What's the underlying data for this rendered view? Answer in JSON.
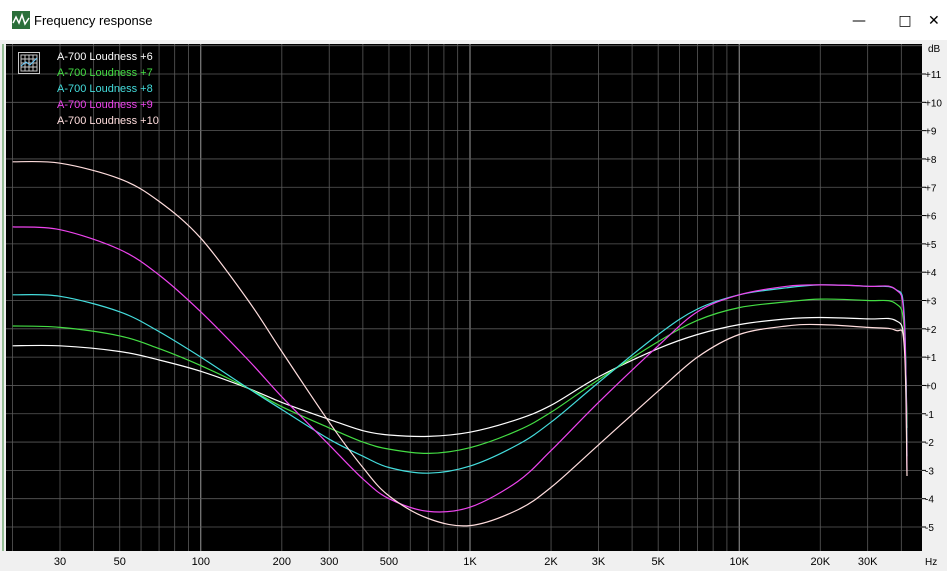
{
  "window": {
    "title": "Frequency response",
    "minimize_icon": "minimize-icon",
    "maximize_icon": "maximize-icon",
    "close_icon": "close-icon"
  },
  "chart_data": {
    "type": "line",
    "title": "",
    "xlabel": "",
    "ylabel": "",
    "x_unit": "Hz",
    "y_unit": "dB",
    "x_scale": "log",
    "xlim": [
      20,
      22000
    ],
    "ylim": [
      -5.5,
      12
    ],
    "x_tick_labels": [
      {
        "value": 30,
        "label": "30"
      },
      {
        "value": 50,
        "label": "50"
      },
      {
        "value": 100,
        "label": "100"
      },
      {
        "value": 200,
        "label": "200"
      },
      {
        "value": 300,
        "label": "300"
      },
      {
        "value": 500,
        "label": "500"
      },
      {
        "value": 1000,
        "label": "1K"
      },
      {
        "value": 2000,
        "label": "2K"
      },
      {
        "value": 3000,
        "label": "3K"
      },
      {
        "value": 5000,
        "label": "5K"
      },
      {
        "value": 10000,
        "label": "10K"
      },
      {
        "value": 20000,
        "label": "20K"
      },
      {
        "value": 30000,
        "label": "30K"
      }
    ],
    "y_tick_labels": [
      {
        "value": 11,
        "label": "+11"
      },
      {
        "value": 10,
        "label": "+10"
      },
      {
        "value": 9,
        "label": "+9"
      },
      {
        "value": 8,
        "label": "+8"
      },
      {
        "value": 7,
        "label": "+7"
      },
      {
        "value": 6,
        "label": "+6"
      },
      {
        "value": 5,
        "label": "+5"
      },
      {
        "value": 4,
        "label": "+4"
      },
      {
        "value": 3,
        "label": "+3"
      },
      {
        "value": 2,
        "label": "+2"
      },
      {
        "value": 1,
        "label": "+1"
      },
      {
        "value": 0,
        "label": "+0"
      },
      {
        "value": -1,
        "label": "-1"
      },
      {
        "value": -2,
        "label": "-2"
      },
      {
        "value": -3,
        "label": "-3"
      },
      {
        "value": -4,
        "label": "-4"
      },
      {
        "value": -5,
        "label": "-5"
      }
    ],
    "grid": true,
    "legend_position": "top-left",
    "background": "#000000",
    "series": [
      {
        "name": "A-700 Loudness +6",
        "color": "#ffffff",
        "points": [
          [
            20,
            1.4
          ],
          [
            30,
            1.4
          ],
          [
            50,
            1.2
          ],
          [
            70,
            0.9
          ],
          [
            100,
            0.5
          ],
          [
            150,
            -0.1
          ],
          [
            200,
            -0.6
          ],
          [
            300,
            -1.2
          ],
          [
            400,
            -1.6
          ],
          [
            500,
            -1.75
          ],
          [
            700,
            -1.8
          ],
          [
            1000,
            -1.65
          ],
          [
            1500,
            -1.2
          ],
          [
            2000,
            -0.7
          ],
          [
            3000,
            0.3
          ],
          [
            5000,
            1.3
          ],
          [
            7000,
            1.8
          ],
          [
            10000,
            2.15
          ],
          [
            15000,
            2.35
          ],
          [
            20000,
            2.4
          ],
          [
            30000,
            2.35
          ],
          [
            38000,
            2.3
          ],
          [
            41000,
            1.6
          ],
          [
            42000,
            -1.5
          ]
        ]
      },
      {
        "name": "A-700 Loudness +7",
        "color": "#44dd44",
        "points": [
          [
            20,
            2.1
          ],
          [
            30,
            2.05
          ],
          [
            50,
            1.75
          ],
          [
            70,
            1.3
          ],
          [
            100,
            0.7
          ],
          [
            150,
            -0.1
          ],
          [
            200,
            -0.75
          ],
          [
            300,
            -1.5
          ],
          [
            400,
            -2.0
          ],
          [
            500,
            -2.25
          ],
          [
            700,
            -2.4
          ],
          [
            1000,
            -2.2
          ],
          [
            1500,
            -1.6
          ],
          [
            2000,
            -0.95
          ],
          [
            3000,
            0.2
          ],
          [
            5000,
            1.55
          ],
          [
            7000,
            2.3
          ],
          [
            10000,
            2.75
          ],
          [
            15000,
            2.95
          ],
          [
            20000,
            3.05
          ],
          [
            30000,
            3.0
          ],
          [
            38000,
            2.9
          ],
          [
            41000,
            2.0
          ],
          [
            42000,
            -2.0
          ]
        ]
      },
      {
        "name": "A-700 Loudness +8",
        "color": "#44dddd",
        "points": [
          [
            20,
            3.2
          ],
          [
            30,
            3.15
          ],
          [
            50,
            2.6
          ],
          [
            70,
            1.9
          ],
          [
            100,
            1.0
          ],
          [
            150,
            -0.1
          ],
          [
            200,
            -0.85
          ],
          [
            300,
            -1.9
          ],
          [
            400,
            -2.5
          ],
          [
            500,
            -2.9
          ],
          [
            700,
            -3.1
          ],
          [
            1000,
            -2.85
          ],
          [
            1500,
            -2.1
          ],
          [
            2000,
            -1.3
          ],
          [
            3000,
            0.1
          ],
          [
            5000,
            1.8
          ],
          [
            7000,
            2.7
          ],
          [
            10000,
            3.2
          ],
          [
            15000,
            3.45
          ],
          [
            20000,
            3.55
          ],
          [
            30000,
            3.5
          ],
          [
            38000,
            3.4
          ],
          [
            41000,
            2.5
          ],
          [
            42000,
            -2.5
          ]
        ]
      },
      {
        "name": "A-700 Loudness +9",
        "color": "#ee44ee",
        "points": [
          [
            20,
            5.6
          ],
          [
            30,
            5.5
          ],
          [
            50,
            4.8
          ],
          [
            70,
            3.9
          ],
          [
            100,
            2.6
          ],
          [
            150,
            0.9
          ],
          [
            200,
            -0.4
          ],
          [
            300,
            -2.1
          ],
          [
            400,
            -3.3
          ],
          [
            500,
            -4.0
          ],
          [
            700,
            -4.45
          ],
          [
            1000,
            -4.3
          ],
          [
            1500,
            -3.4
          ],
          [
            2000,
            -2.3
          ],
          [
            3000,
            -0.6
          ],
          [
            5000,
            1.4
          ],
          [
            7000,
            2.6
          ],
          [
            10000,
            3.2
          ],
          [
            15000,
            3.5
          ],
          [
            20000,
            3.55
          ],
          [
            30000,
            3.5
          ],
          [
            38000,
            3.4
          ],
          [
            41000,
            2.3
          ],
          [
            42000,
            -3.0
          ]
        ]
      },
      {
        "name": "A-700 Loudness +10",
        "color": "#ffdddd",
        "points": [
          [
            20,
            7.9
          ],
          [
            30,
            7.85
          ],
          [
            50,
            7.3
          ],
          [
            70,
            6.5
          ],
          [
            100,
            5.2
          ],
          [
            150,
            3.0
          ],
          [
            200,
            1.2
          ],
          [
            300,
            -1.3
          ],
          [
            400,
            -2.9
          ],
          [
            500,
            -3.9
          ],
          [
            700,
            -4.7
          ],
          [
            1000,
            -4.95
          ],
          [
            1500,
            -4.4
          ],
          [
            2000,
            -3.6
          ],
          [
            3000,
            -2.1
          ],
          [
            5000,
            -0.2
          ],
          [
            7000,
            1.0
          ],
          [
            10000,
            1.8
          ],
          [
            15000,
            2.1
          ],
          [
            20000,
            2.15
          ],
          [
            30000,
            2.05
          ],
          [
            38000,
            1.95
          ],
          [
            41000,
            1.4
          ],
          [
            42000,
            -3.2
          ]
        ]
      }
    ]
  }
}
